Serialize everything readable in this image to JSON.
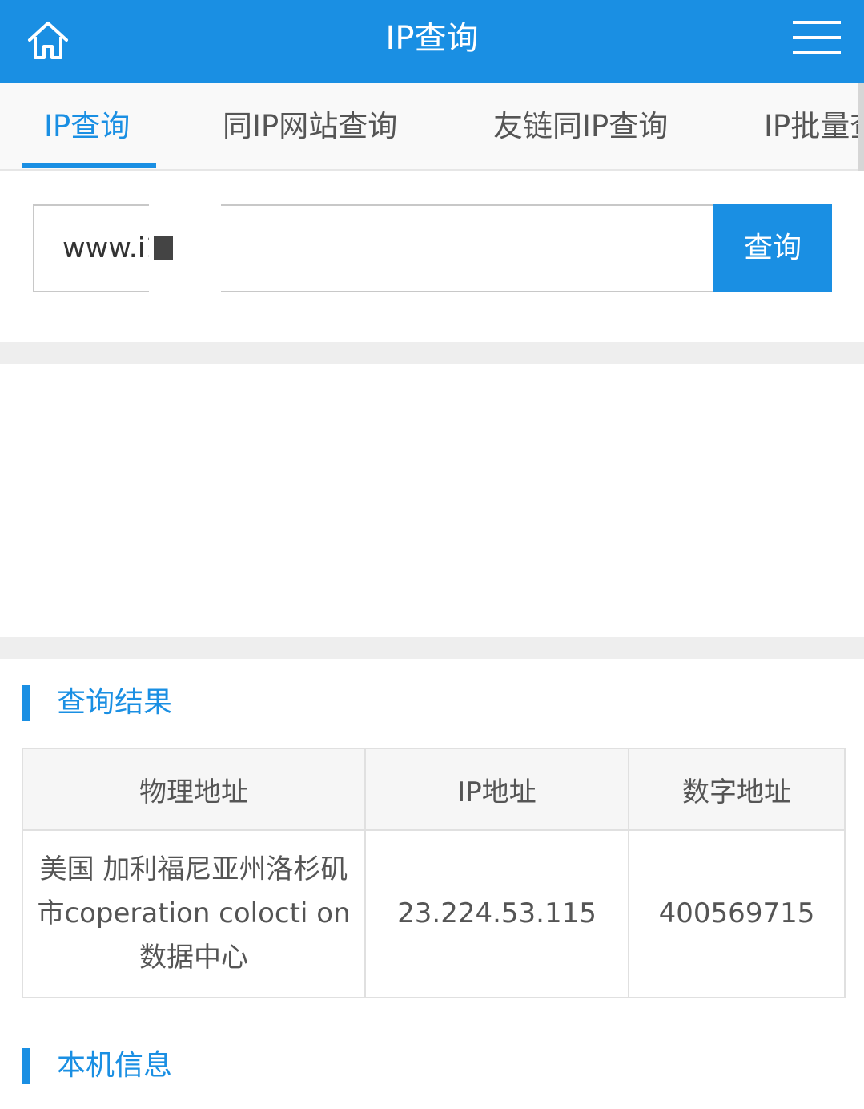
{
  "header": {
    "title": "IP查询",
    "home_icon": "home-icon",
    "menu_icon": "menu-icon",
    "brand_color": "#1a8fe3"
  },
  "tabs": [
    {
      "label": "IP查询",
      "active": true
    },
    {
      "label": "同IP网站查询",
      "active": false
    },
    {
      "label": "友链同IP查询",
      "active": false
    },
    {
      "label": "IP批量查",
      "active": false
    }
  ],
  "search": {
    "value": "www.i1        n",
    "button_label": "查询"
  },
  "result_section": {
    "title": "查询结果",
    "columns": [
      "物理地址",
      "IP地址",
      "数字地址"
    ],
    "rows": [
      [
        "美国 加利福尼亚州洛杉矶市coperation colocti on数据中心",
        "23.224.53.115",
        "400569715"
      ]
    ]
  },
  "local_section": {
    "title": "本机信息"
  }
}
